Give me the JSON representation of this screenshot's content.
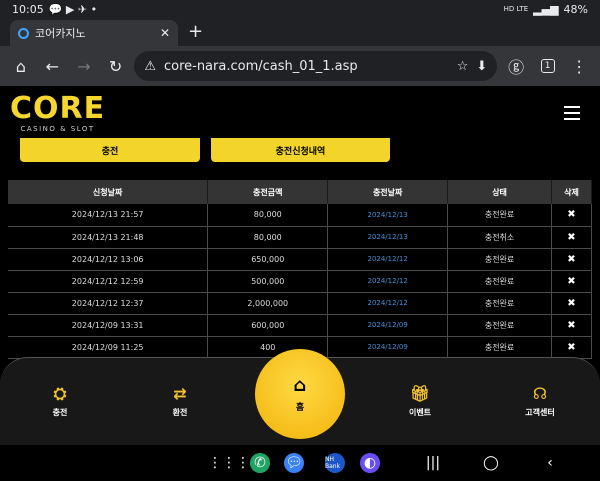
{
  "status": {
    "time": "10:05",
    "battery": "48%",
    "net": "HD LTE"
  },
  "browser": {
    "tab_title": "코어카지노",
    "url": "core-nara.com/cash_01_1.asp",
    "tab_count": "1"
  },
  "site": {
    "logo_main": "CORE",
    "logo_sub": "CASINO & SLOT"
  },
  "buttons": {
    "charge": "충전",
    "history": "충전신청내역"
  },
  "table": {
    "headers": [
      "신청날짜",
      "충전금액",
      "충전날짜",
      "상태",
      "삭제"
    ],
    "rows": [
      {
        "req_date": "2024/12/13 21:57",
        "amount": "80,000",
        "charge_date": "2024/12/13",
        "status": "충전완료",
        "del": "✖"
      },
      {
        "req_date": "2024/12/13 21:48",
        "amount": "80,000",
        "charge_date": "2024/12/13",
        "status": "충전취소",
        "del": "✖"
      },
      {
        "req_date": "2024/12/12 13:06",
        "amount": "650,000",
        "charge_date": "2024/12/12",
        "status": "충전완료",
        "del": "✖"
      },
      {
        "req_date": "2024/12/12 12:59",
        "amount": "500,000",
        "charge_date": "2024/12/12",
        "status": "충전완료",
        "del": "✖"
      },
      {
        "req_date": "2024/12/12 12:37",
        "amount": "2,000,000",
        "charge_date": "2024/12/12",
        "status": "충전완료",
        "del": "✖"
      },
      {
        "req_date": "2024/12/09 13:31",
        "amount": "600,000",
        "charge_date": "2024/12/09",
        "status": "충전완료",
        "del": "✖"
      },
      {
        "req_date": "2024/12/09 11:25",
        "amount": "400",
        "charge_date": "2024/12/09",
        "status": "충전완료",
        "del": "✖"
      }
    ]
  },
  "bottom_nav": {
    "charge": "충전",
    "exchange": "환전",
    "home": "홈",
    "event": "이벤트",
    "support": "고객센터"
  },
  "sysapps": {
    "bank_label": "NH Bank"
  }
}
